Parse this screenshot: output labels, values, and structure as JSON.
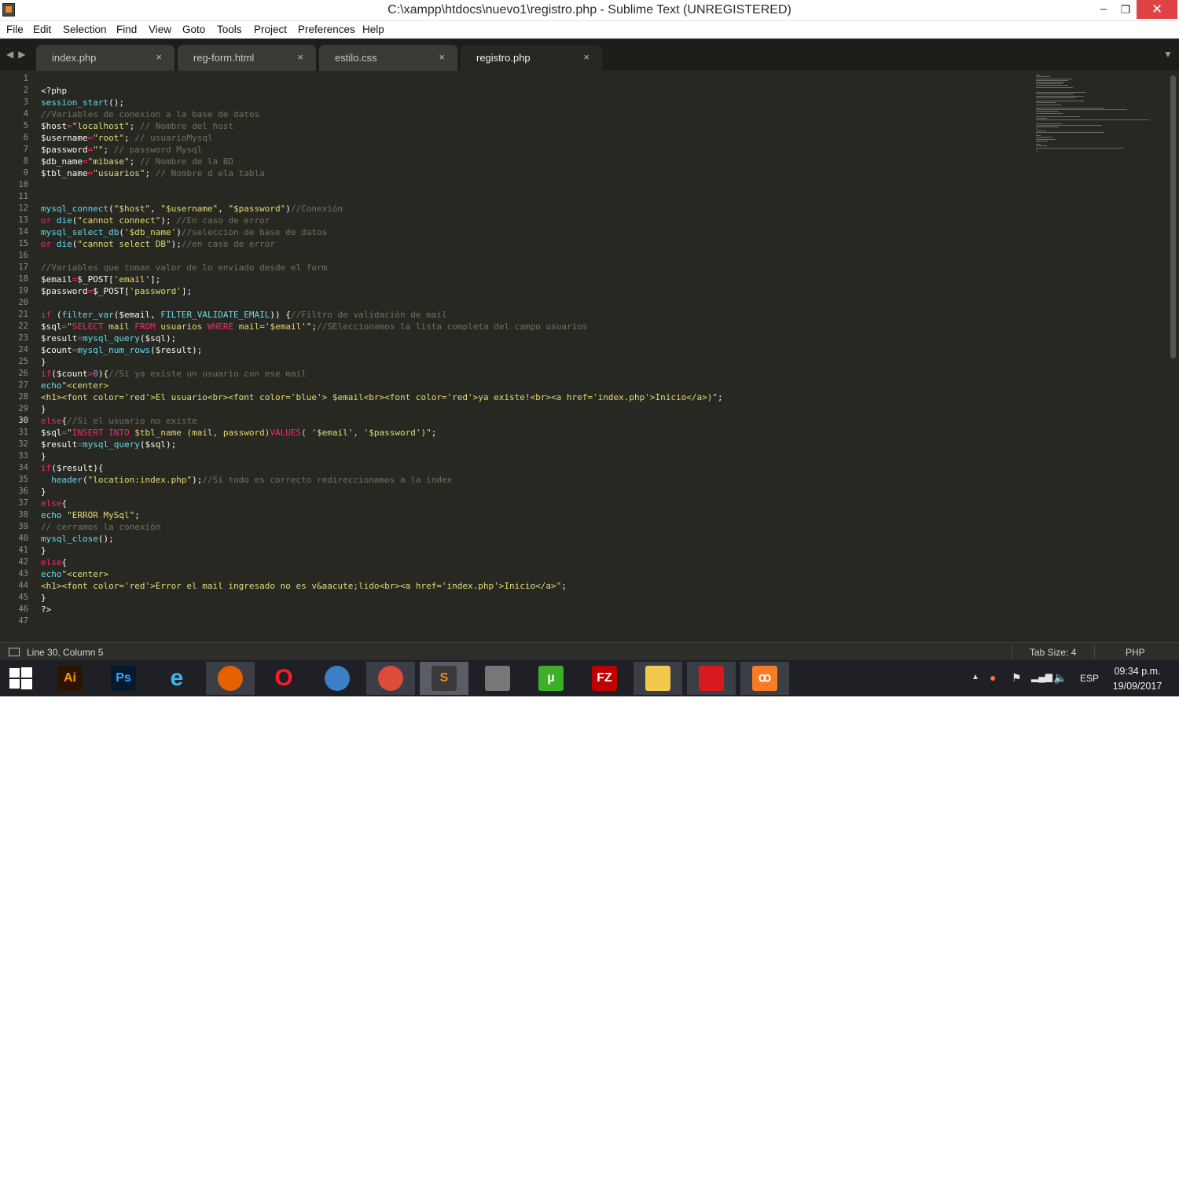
{
  "window": {
    "title": "C:\\xampp\\htdocs\\nuevo1\\registro.php - Sublime Text (UNREGISTERED)",
    "minimize": "–",
    "maximize": "❐",
    "close": "✕"
  },
  "menu": [
    "File",
    "Edit",
    "Selection",
    "Find",
    "View",
    "Goto",
    "Tools",
    "Project",
    "Preferences",
    "Help"
  ],
  "tab_nav": "◀▶",
  "tab_dropdown": "▼",
  "tabs": [
    {
      "label": "index.php",
      "active": false
    },
    {
      "label": "reg-form.html",
      "active": false
    },
    {
      "label": "estilo.css",
      "active": false
    },
    {
      "label": "registro.php",
      "active": true
    }
  ],
  "tab_close": "×",
  "editor": {
    "active_line": 30,
    "lines": [
      [],
      [
        [
          "t",
          "<?php"
        ]
      ],
      [
        [
          "f",
          "session_start"
        ],
        [
          "t",
          "();"
        ]
      ],
      [
        [
          "c",
          "//Variables de conexion a la base de datos"
        ]
      ],
      [
        [
          "t",
          "$host"
        ],
        [
          "k",
          "="
        ],
        [
          "s",
          "\"localhost\""
        ],
        [
          "t",
          "; "
        ],
        [
          "c",
          "// Nombre del host"
        ]
      ],
      [
        [
          "t",
          "$username"
        ],
        [
          "k",
          "="
        ],
        [
          "s",
          "\"root\""
        ],
        [
          "t",
          "; "
        ],
        [
          "c",
          "// usuarioMysql"
        ]
      ],
      [
        [
          "t",
          "$password"
        ],
        [
          "k",
          "="
        ],
        [
          "s",
          "\"\""
        ],
        [
          "t",
          "; "
        ],
        [
          "c",
          "// password Mysql"
        ]
      ],
      [
        [
          "t",
          "$db_name"
        ],
        [
          "k",
          "="
        ],
        [
          "s",
          "\"mibase\""
        ],
        [
          "t",
          "; "
        ],
        [
          "c",
          "// Nombre de la BD"
        ]
      ],
      [
        [
          "t",
          "$tbl_name"
        ],
        [
          "k",
          "="
        ],
        [
          "s",
          "\"usuarios\""
        ],
        [
          "t",
          "; "
        ],
        [
          "c",
          "// Nombre d ela tabla"
        ]
      ],
      [],
      [],
      [
        [
          "f",
          "mysql_connect"
        ],
        [
          "t",
          "("
        ],
        [
          "s",
          "\"$host\""
        ],
        [
          "t",
          ", "
        ],
        [
          "s",
          "\"$username\""
        ],
        [
          "t",
          ", "
        ],
        [
          "s",
          "\"$password\""
        ],
        [
          "t",
          ")"
        ],
        [
          "c",
          "//Conexión"
        ]
      ],
      [
        [
          "k",
          "or"
        ],
        [
          "t",
          " "
        ],
        [
          "f",
          "die"
        ],
        [
          "t",
          "("
        ],
        [
          "s",
          "\"cannot connect\""
        ],
        [
          "t",
          "); "
        ],
        [
          "c",
          "//En caso de error"
        ]
      ],
      [
        [
          "f",
          "mysql_select_db"
        ],
        [
          "t",
          "("
        ],
        [
          "s",
          "'$db_name'"
        ],
        [
          "t",
          ")"
        ],
        [
          "c",
          "//seleccion de base de datos"
        ]
      ],
      [
        [
          "k",
          "or"
        ],
        [
          "t",
          " "
        ],
        [
          "f",
          "die"
        ],
        [
          "t",
          "("
        ],
        [
          "s",
          "\"cannot select DB\""
        ],
        [
          "t",
          ");"
        ],
        [
          "c",
          "//en caso de error"
        ]
      ],
      [],
      [
        [
          "c",
          "//Variables que toman valor de lo enviado desde el form"
        ]
      ],
      [
        [
          "t",
          "$email"
        ],
        [
          "k",
          "="
        ],
        [
          "t",
          "$_POST["
        ],
        [
          "s",
          "'email'"
        ],
        [
          "t",
          "];"
        ]
      ],
      [
        [
          "t",
          "$password"
        ],
        [
          "k",
          "="
        ],
        [
          "t",
          "$_POST["
        ],
        [
          "s",
          "'password'"
        ],
        [
          "t",
          "];"
        ]
      ],
      [],
      [
        [
          "k",
          "if"
        ],
        [
          "t",
          " ("
        ],
        [
          "f",
          "filter_var"
        ],
        [
          "t",
          "($email, "
        ],
        [
          "f",
          "FILTER_VALIDATE_EMAIL"
        ],
        [
          "t",
          ")) {"
        ],
        [
          "c",
          "//Filtro de validación de mail"
        ]
      ],
      [
        [
          "t",
          "$sql"
        ],
        [
          "k",
          "="
        ],
        [
          "s",
          "\""
        ],
        [
          "k",
          "SELECT"
        ],
        [
          "s",
          " mail "
        ],
        [
          "k",
          "FROM"
        ],
        [
          "s",
          " usuarios "
        ],
        [
          "k",
          "WHERE"
        ],
        [
          "s",
          " mail='$email'\""
        ],
        [
          "t",
          ";"
        ],
        [
          "c",
          "//SEleccionamos la lista completa del campo usuarios"
        ]
      ],
      [
        [
          "t",
          "$result"
        ],
        [
          "k",
          "="
        ],
        [
          "f",
          "mysql_query"
        ],
        [
          "t",
          "($sql);"
        ]
      ],
      [
        [
          "t",
          "$count"
        ],
        [
          "k",
          "="
        ],
        [
          "f",
          "mysql_num_rows"
        ],
        [
          "t",
          "($result);"
        ]
      ],
      [
        [
          "t",
          "}"
        ]
      ],
      [
        [
          "k",
          "if"
        ],
        [
          "t",
          "($count"
        ],
        [
          "k",
          ">"
        ],
        [
          "n",
          "0"
        ],
        [
          "t",
          "){"
        ],
        [
          "c",
          "//Si ya existe un usuario con ese mail"
        ]
      ],
      [
        [
          "f",
          "echo"
        ],
        [
          "s",
          "\"<center>"
        ]
      ],
      [
        [
          "s",
          "<h1><font color='red'>El usuario<br><font color='blue'> $email<br><font color='red'>ya existe!<br><a href='index.php'>Inicio</a>)\""
        ],
        [
          "t",
          ";"
        ]
      ],
      [
        [
          "t",
          "}"
        ]
      ],
      [
        [
          "k",
          "else"
        ],
        [
          "t",
          "{"
        ],
        [
          "c",
          "//Si el usuario no existe"
        ]
      ],
      [
        [
          "t",
          "$sql"
        ],
        [
          "k",
          "="
        ],
        [
          "s",
          "\""
        ],
        [
          "k",
          "INSERT INTO"
        ],
        [
          "s",
          " $tbl_name (mail, password)"
        ],
        [
          "k",
          "VALUES"
        ],
        [
          "s",
          "( '$email', '$password')\""
        ],
        [
          "t",
          ";"
        ]
      ],
      [
        [
          "t",
          "$result"
        ],
        [
          "k",
          "="
        ],
        [
          "f",
          "mysql_query"
        ],
        [
          "t",
          "($sql);"
        ]
      ],
      [
        [
          "t",
          "}"
        ]
      ],
      [
        [
          "k",
          "if"
        ],
        [
          "t",
          "($result){"
        ]
      ],
      [
        [
          "t",
          "  "
        ],
        [
          "f",
          "header"
        ],
        [
          "t",
          "("
        ],
        [
          "s",
          "\"location:index.php\""
        ],
        [
          "t",
          ");"
        ],
        [
          "c",
          "//Si todo es correcto redireccionamos a la index"
        ]
      ],
      [
        [
          "t",
          "}"
        ]
      ],
      [
        [
          "k",
          "else"
        ],
        [
          "t",
          "{"
        ]
      ],
      [
        [
          "f",
          "echo"
        ],
        [
          "t",
          " "
        ],
        [
          "s",
          "\"ERROR MySql\""
        ],
        [
          "t",
          ";"
        ]
      ],
      [
        [
          "c",
          "// cerramos la conexión"
        ]
      ],
      [
        [
          "f",
          "mysql_close"
        ],
        [
          "t",
          "();"
        ]
      ],
      [
        [
          "t",
          "}"
        ]
      ],
      [
        [
          "k",
          "else"
        ],
        [
          "t",
          "{"
        ]
      ],
      [
        [
          "f",
          "echo"
        ],
        [
          "s",
          "\"<center>"
        ]
      ],
      [
        [
          "s",
          "<h1><font color='red'>Error el mail ingresado no es v&aacute;lido<br><a href='index.php'>Inicio</a>\""
        ],
        [
          "t",
          ";"
        ]
      ],
      [
        [
          "t",
          "}"
        ]
      ],
      [
        [
          "t",
          "?>"
        ]
      ],
      []
    ]
  },
  "status": {
    "position": "Line 30, Column 5",
    "tab_size": "Tab Size: 4",
    "syntax": "PHP"
  },
  "taskbar": {
    "apps": [
      {
        "name": "illustrator",
        "glyph": "Ai",
        "bg": "#2b1500",
        "fg": "#ff9a00",
        "active": false
      },
      {
        "name": "photoshop",
        "glyph": "Ps",
        "bg": "#061a2e",
        "fg": "#31a8ff",
        "active": false
      },
      {
        "name": "internet-explorer",
        "glyph": "e",
        "bg": "transparent",
        "fg": "#3cb6ee",
        "active": false
      },
      {
        "name": "firefox",
        "glyph": "",
        "bg": "#e66000",
        "fg": "#ffcb00",
        "active": true
      },
      {
        "name": "opera",
        "glyph": "O",
        "bg": "transparent",
        "fg": "#ff1b2d",
        "active": false
      },
      {
        "name": "network-tool",
        "glyph": "",
        "bg": "#3d7fc4",
        "fg": "#ffffff",
        "active": false
      },
      {
        "name": "chrome",
        "glyph": "",
        "bg": "#dd4b39",
        "fg": "#ffffff",
        "active": true
      },
      {
        "name": "sublime-text",
        "glyph": "S",
        "bg": "#3a3a3a",
        "fg": "#f08a24",
        "active": true,
        "current": true
      },
      {
        "name": "media-tool",
        "glyph": "",
        "bg": "#777777",
        "fg": "#ffffff",
        "active": false
      },
      {
        "name": "utorrent",
        "glyph": "µ",
        "bg": "#3fae29",
        "fg": "#ffffff",
        "active": false
      },
      {
        "name": "filezilla",
        "glyph": "FZ",
        "bg": "#bf0000",
        "fg": "#ffffff",
        "active": false
      },
      {
        "name": "file-explorer",
        "glyph": "",
        "bg": "#f2c94c",
        "fg": "#ffffff",
        "active": true
      },
      {
        "name": "acrobat",
        "glyph": "",
        "bg": "#d71920",
        "fg": "#ffffff",
        "active": true
      },
      {
        "name": "xampp",
        "glyph": "ꝏ",
        "bg": "#fb7a24",
        "fg": "#ffffff",
        "active": true
      }
    ],
    "tray_arrow": "▲",
    "language": "ESP",
    "time": "09:34 p.m.",
    "date": "19/09/2017"
  }
}
